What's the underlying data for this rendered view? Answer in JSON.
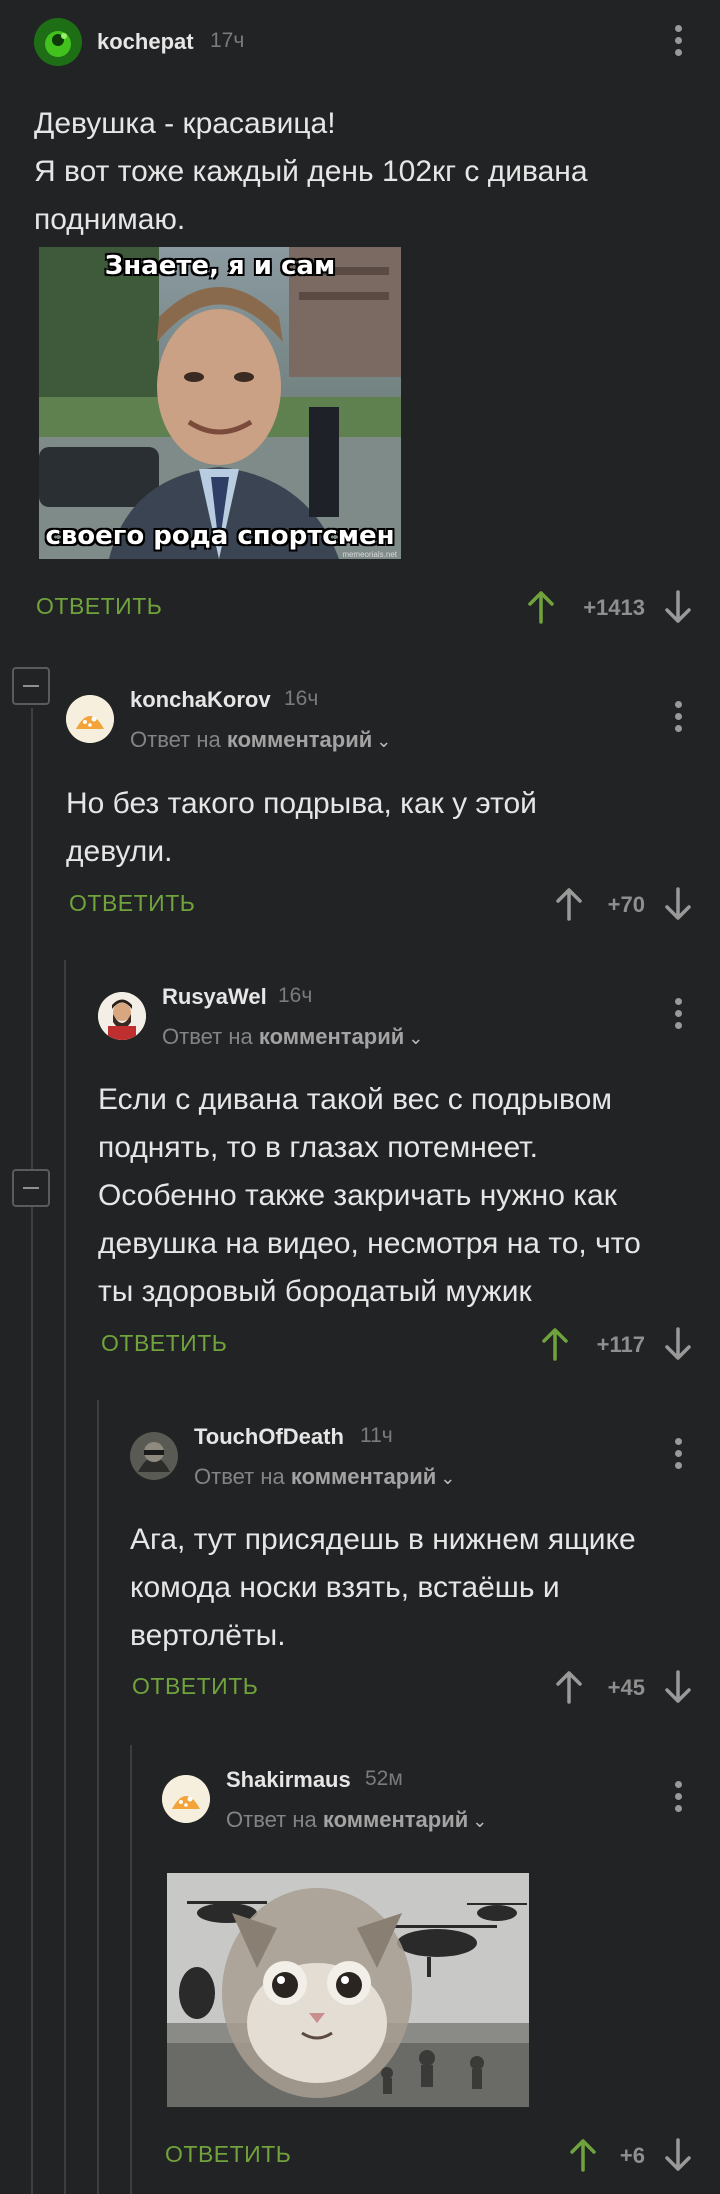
{
  "colors": {
    "background": "#222325",
    "accent_green": "#70a33c",
    "upvote_active": "#70a33c",
    "muted": "#8f8f8f"
  },
  "reply_label": "ОТВЕТИТЬ",
  "reply_to_prefix": "Ответ на",
  "reply_to_link": "комментарий",
  "comments": [
    {
      "author": "kochepat",
      "time": "17ч",
      "text_lines": [
        "Девушка - красавица!",
        "Я вот тоже каждый день 102кг с дивана",
        "поднимаю."
      ],
      "meme_top": "Знаете, я и сам",
      "meme_bottom": "своего рода спортсмен",
      "meme_watermark": "memeorials.net",
      "score": "+1413",
      "upvoted": true
    },
    {
      "author": "konchaKorov",
      "time": "16ч",
      "text_lines": [
        "Но без такого подрыва, как у этой",
        "девули."
      ],
      "score": "+70",
      "upvoted": false
    },
    {
      "author": "RusyaWel",
      "time": "16ч",
      "text_lines": [
        "Если с дивана такой вес с подрывом",
        "поднять, то в глазах потемнеет.",
        "Особенно также закричать нужно как",
        "девушка на видео, несмотря на то, что",
        "ты здоровый бородатый мужик"
      ],
      "score": "+117",
      "upvoted": true
    },
    {
      "author": "TouchOfDeath",
      "time": "11ч",
      "text_lines": [
        "Ага, тут присядешь в нижнем ящике",
        "комода носки взять, встаёшь и",
        "вертолёты."
      ],
      "score": "+45",
      "upvoted": false
    },
    {
      "author": "Shakirmaus",
      "time": "52м",
      "score": "+6",
      "upvoted": true
    }
  ]
}
